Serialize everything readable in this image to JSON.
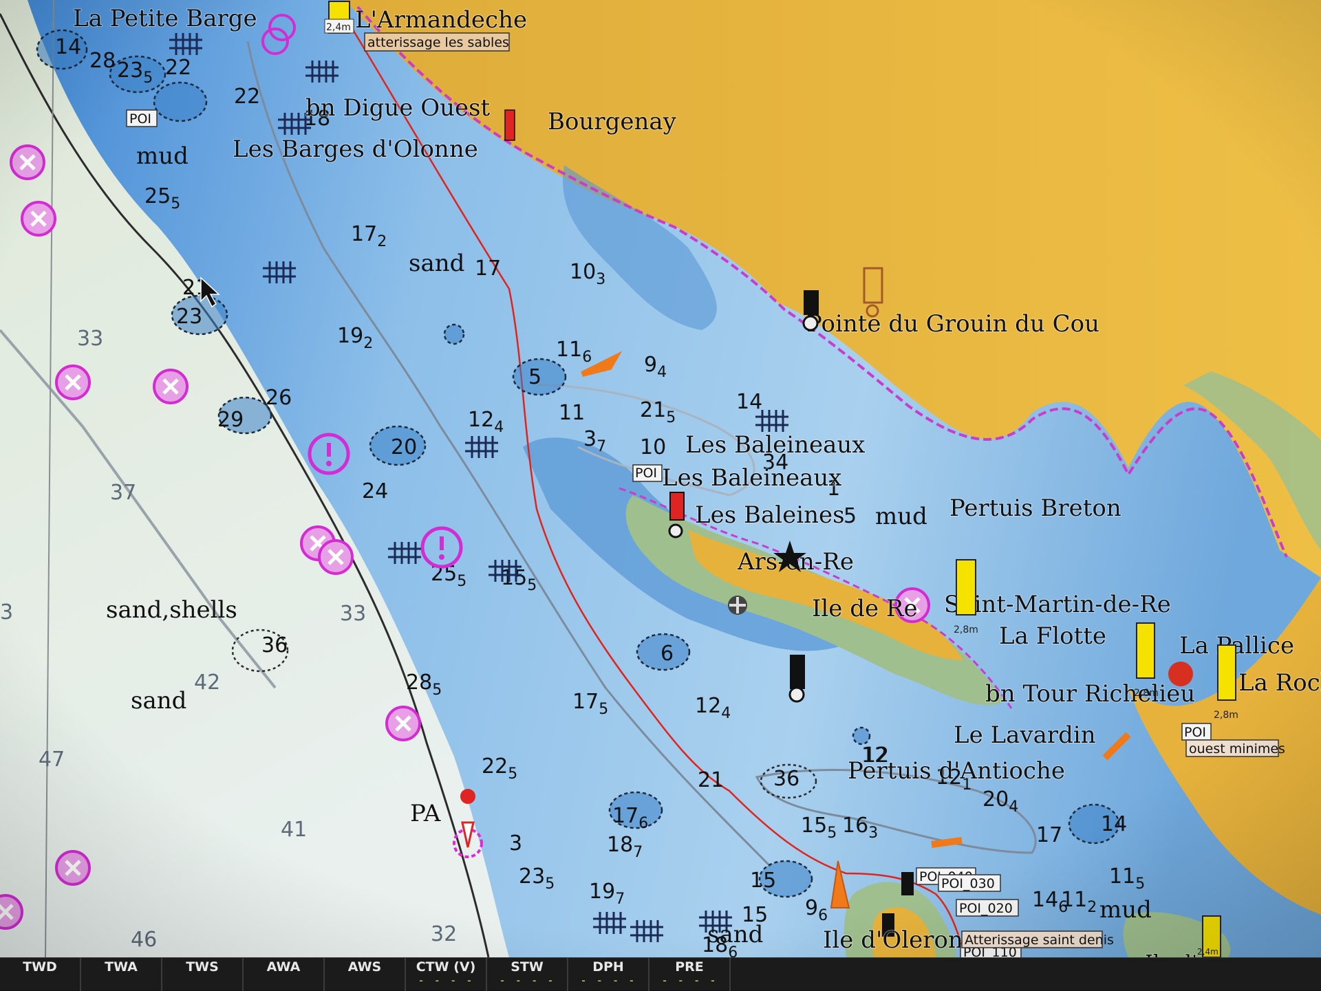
{
  "places": [
    {
      "id": "la-petite-barge",
      "label": "La Petite Barge"
    },
    {
      "id": "l-armandeche",
      "label": "L'Armandeche"
    },
    {
      "id": "bn-digue-ouest",
      "label": "bn Digue Ouest"
    },
    {
      "id": "bourgenay",
      "label": "Bourgenay"
    },
    {
      "id": "les-barges-d-olonne",
      "label": "Les Barges d'Olonne"
    },
    {
      "id": "pointe-du-grouin-du-cou",
      "label": "Pointe du Grouin du Cou"
    },
    {
      "id": "les-baleineaux-1",
      "label": "Les Baleineaux"
    },
    {
      "id": "les-baleineaux-2",
      "label": "Les Baleineaux"
    },
    {
      "id": "les-baleines",
      "label": "Les Baleines"
    },
    {
      "id": "pertuis-breton",
      "label": "Pertuis Breton"
    },
    {
      "id": "ars-en-re",
      "label": "Ars-en-Re"
    },
    {
      "id": "ile-de-re",
      "label": "Ile de Re"
    },
    {
      "id": "saint-martin-de-re",
      "label": "Saint-Martin-de-Re"
    },
    {
      "id": "la-flotte",
      "label": "La Flotte"
    },
    {
      "id": "la-pallice",
      "label": "La Pallice"
    },
    {
      "id": "la-rochelle",
      "label": "La Roche"
    },
    {
      "id": "bn-tour-richelieu",
      "label": "bn Tour Richelieu"
    },
    {
      "id": "le-lavardin",
      "label": "Le Lavardin"
    },
    {
      "id": "pertuis-d-antioche",
      "label": "Pertuis d'Antioche"
    },
    {
      "id": "pa",
      "label": "PA"
    },
    {
      "id": "ile-d-oleron",
      "label": "Ile d'Oleron"
    },
    {
      "id": "ile-d-aix",
      "label": "Ile d'Aix"
    }
  ],
  "seabed": [
    {
      "id": "mud-1",
      "label": "mud"
    },
    {
      "id": "sand-1",
      "label": "sand"
    },
    {
      "id": "mud-2",
      "label": "mud"
    },
    {
      "id": "sand-shells",
      "label": "sand,shells"
    },
    {
      "id": "sand-2",
      "label": "sand"
    },
    {
      "id": "mud-3",
      "label": "mud"
    },
    {
      "id": "sand-3",
      "label": "sand"
    }
  ],
  "depths": [
    {
      "main": "14",
      "sub": ""
    },
    {
      "main": "28",
      "sub": ""
    },
    {
      "main": "23",
      "sub": "5"
    },
    {
      "main": "22",
      "sub": ""
    },
    {
      "main": "22",
      "sub": ""
    },
    {
      "main": "25",
      "sub": "5"
    },
    {
      "main": "17",
      "sub": "2"
    },
    {
      "main": "17",
      "sub": ""
    },
    {
      "main": "10",
      "sub": "3"
    },
    {
      "main": "21",
      "sub": ""
    },
    {
      "main": "23",
      "sub": ""
    },
    {
      "main": "19",
      "sub": "2"
    },
    {
      "main": "11",
      "sub": "6"
    },
    {
      "main": "5",
      "sub": ""
    },
    {
      "main": "9",
      "sub": "4"
    },
    {
      "main": "12",
      "sub": "4"
    },
    {
      "main": "11",
      "sub": ""
    },
    {
      "main": "21",
      "sub": "5"
    },
    {
      "main": "14",
      "sub": ""
    },
    {
      "main": "29",
      "sub": ""
    },
    {
      "main": "26",
      "sub": ""
    },
    {
      "main": "20",
      "sub": ""
    },
    {
      "main": "3",
      "sub": "7"
    },
    {
      "main": "10",
      "sub": ""
    },
    {
      "main": "24",
      "sub": ""
    },
    {
      "main": "25",
      "sub": "5"
    },
    {
      "main": "15",
      "sub": "5"
    },
    {
      "main": "6",
      "sub": ""
    },
    {
      "main": "28",
      "sub": "5"
    },
    {
      "main": "17",
      "sub": "5"
    },
    {
      "main": "12",
      "sub": "4"
    },
    {
      "main": "22",
      "sub": "5"
    },
    {
      "main": "21",
      "sub": ""
    },
    {
      "main": "12",
      "sub": ""
    },
    {
      "main": "12",
      "sub": "1"
    },
    {
      "main": "18",
      "sub": "7"
    },
    {
      "main": "17",
      "sub": "6"
    },
    {
      "main": "15",
      "sub": "5"
    },
    {
      "main": "16",
      "sub": "3"
    },
    {
      "main": "20",
      "sub": "4"
    },
    {
      "main": "14",
      "sub": ""
    },
    {
      "main": "17",
      "sub": ""
    },
    {
      "main": "23",
      "sub": "5"
    },
    {
      "main": "19",
      "sub": "7"
    },
    {
      "main": "15",
      "sub": ""
    },
    {
      "main": "15",
      "sub": ""
    },
    {
      "main": "9",
      "sub": "6"
    },
    {
      "main": "14",
      "sub": "6"
    },
    {
      "main": "11",
      "sub": "2"
    },
    {
      "main": "11",
      "sub": "5"
    },
    {
      "main": "18",
      "sub": "6"
    },
    {
      "main": "1",
      "sub": ""
    },
    {
      "main": "5",
      "sub": ""
    },
    {
      "main": "36",
      "sub": ""
    },
    {
      "main": "18",
      "sub": ""
    },
    {
      "main": "3",
      "sub": ""
    },
    {
      "main": "36",
      "sub": ""
    },
    {
      "main": "12",
      "sub": ""
    },
    {
      "main": "34",
      "sub": ""
    }
  ],
  "deep_depths": [
    "33",
    "37",
    "3",
    "33",
    "42",
    "47",
    "41",
    "46",
    "32"
  ],
  "tags": {
    "poi_1": "POI",
    "poi_2": "POI",
    "poi_3": "POI",
    "poi_040": "POI_040",
    "poi_030": "POI_030",
    "poi_020": "POI_020",
    "poi_110": "POI_110",
    "atterissage_sables": "atterissage les sables",
    "ouest_minimes": "ouest minimes",
    "atterissage_saint_denis": "Atterissage saint denis",
    "tide_1": "2,4m",
    "tide_2": "2,8m",
    "tide_3": "2,8m",
    "tide_4": "2,8m",
    "tide_5": "2,4m"
  },
  "instrument_bar": [
    {
      "label": "TWD",
      "value": ""
    },
    {
      "label": "TWA",
      "value": ""
    },
    {
      "label": "TWS",
      "value": ""
    },
    {
      "label": "AWA",
      "value": ""
    },
    {
      "label": "AWS",
      "value": ""
    },
    {
      "label": "CTW (V)",
      "value": "- - - -"
    },
    {
      "label": "STW",
      "value": "- - - -"
    },
    {
      "label": "DPH",
      "value": "- - - -"
    },
    {
      "label": "PRE",
      "value": "- - - -"
    }
  ],
  "colors": {
    "land": "#e6b23c",
    "foreshore": "#9fbf8e",
    "deep_water": "#e4efe6",
    "mid_water": "#b9d6ef",
    "shallow_water": "#5f9fd9",
    "danger_magenta": "#e02ad8",
    "route": "#e0241b",
    "instrument_value": "#f0e060"
  }
}
